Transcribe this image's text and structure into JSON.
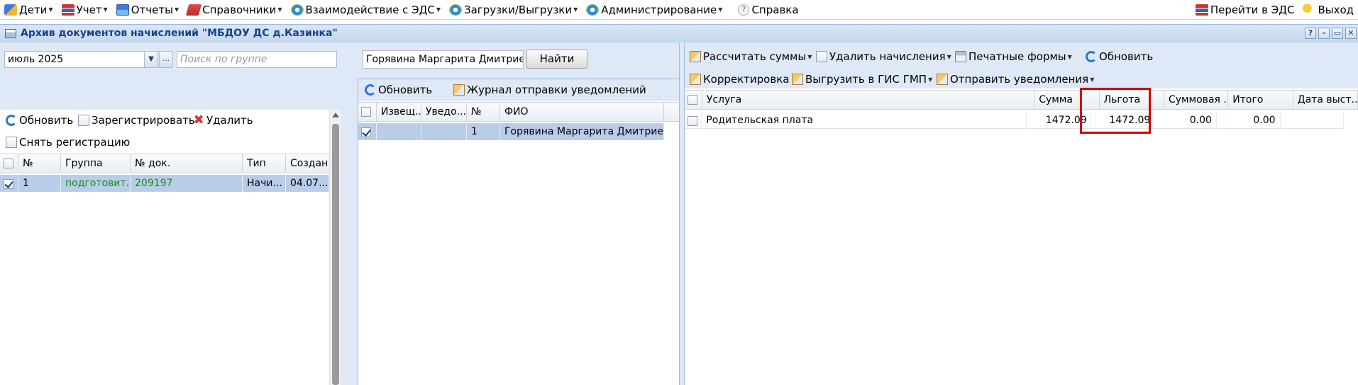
{
  "menu": {
    "items": [
      {
        "label": "Дети",
        "icon": "children-icon",
        "caret": true
      },
      {
        "label": "Учет",
        "icon": "books-icon",
        "caret": true
      },
      {
        "label": "Отчеты",
        "icon": "reports-icon",
        "caret": true
      },
      {
        "label": "Справочники",
        "icon": "book-icon",
        "caret": true
      },
      {
        "label": "Взаимодействие с ЭДС",
        "icon": "gear-icon",
        "caret": true
      },
      {
        "label": "Загрузки/Выгрузки",
        "icon": "gear-icon",
        "caret": true
      },
      {
        "label": "Администрирование",
        "icon": "gear-icon",
        "caret": true
      },
      {
        "label": "Справка",
        "icon": "help-icon",
        "caret": false
      }
    ],
    "goto_eds": "Перейти в ЭДС",
    "logout": "Выход"
  },
  "window": {
    "title": "Архив документов начислений \"МБДОУ ДС д.Казинка\"",
    "tools": [
      "?",
      "–",
      "▭",
      "✕"
    ]
  },
  "left": {
    "period": "июль 2025",
    "search_placeholder": "Поиск по группе",
    "toolbar": {
      "refresh": "Обновить",
      "register": "Зарегистрировать",
      "delete": "Удалить",
      "unregister": "Снять регистрацию"
    },
    "columns": [
      "№",
      "Группа",
      "№ док.",
      "Тип",
      "Создан"
    ],
    "rows": [
      {
        "num": "1",
        "group": "подготовит...",
        "doc": "209197",
        "type": "Начи...",
        "created": "04.07...",
        "checked": true
      }
    ]
  },
  "middle": {
    "search_value": "Горявина Маргарита Дмитриевна",
    "find_button": "Найти",
    "toolbar": {
      "refresh": "Обновить",
      "journal": "Журнал отправки уведомлений"
    },
    "columns": [
      "Извещ...",
      "Уведо...",
      "№",
      "ФИО"
    ],
    "rows": [
      {
        "izv": "",
        "uved": "",
        "num": "1",
        "fio": "Горявина Маргарита Дмитриевна",
        "checked": true
      }
    ]
  },
  "right": {
    "toolbar": {
      "calc": "Рассчитать суммы",
      "delete_charges": "Удалить начисления",
      "print_forms": "Печатные формы",
      "refresh": "Обновить",
      "correction": "Корректировка",
      "export_gis": "Выгрузить в ГИС ГМП",
      "send_notify": "Отправить уведомления"
    },
    "columns": [
      "Услуга",
      "Сумма",
      "Льгота",
      "Суммовая ...",
      "Итого",
      "Дата выст..."
    ],
    "rows": [
      {
        "service": "Родительская плата",
        "sum": "1472.09",
        "benefit": "1472.09",
        "sum_ext": "0.00",
        "total": "0.00",
        "date": ""
      }
    ]
  }
}
